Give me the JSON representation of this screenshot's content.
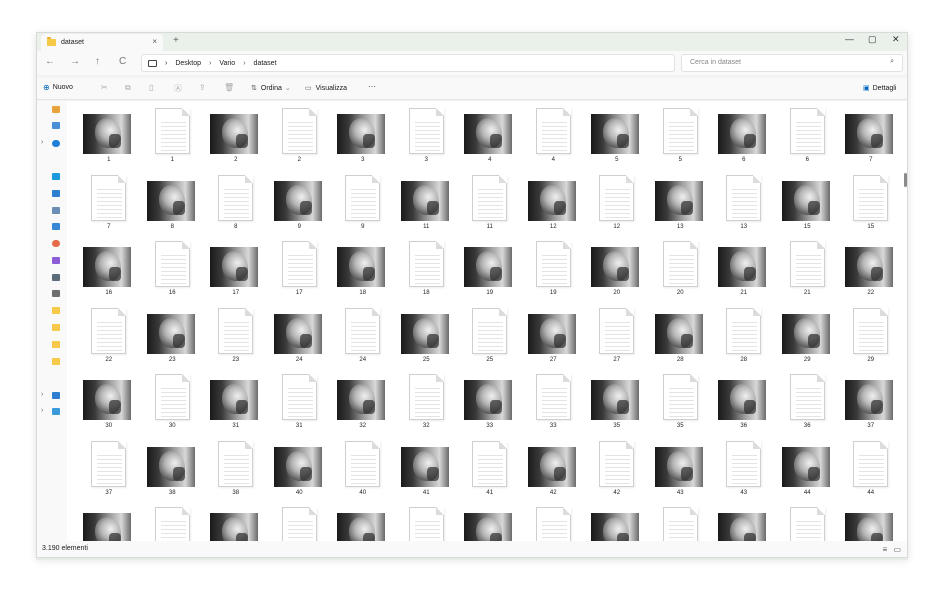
{
  "tab": {
    "title": "dataset",
    "close": "×",
    "new_tab": "+"
  },
  "window_controls": {
    "minimize": "—",
    "maximize": "▢",
    "close": "✕"
  },
  "nav": {
    "back": "←",
    "forward": "→",
    "up": "↑",
    "refresh": "C"
  },
  "breadcrumb": [
    "Desktop",
    "Vario",
    "dataset"
  ],
  "breadcrumb_separator": "›",
  "search": {
    "placeholder": "Cerca in dataset"
  },
  "commands": {
    "new_label": "Nuovo",
    "sort_label": "Ordina",
    "view_label": "Visualizza",
    "more_label": "···",
    "details_label": "Dettagli"
  },
  "status": {
    "item_count": "3.190 elementi"
  },
  "colors": {
    "accent": "#0067c0",
    "folder": "#f7c948"
  },
  "files": [
    {
      "t": "x",
      "n": "1"
    },
    {
      "t": "d",
      "n": "1"
    },
    {
      "t": "x",
      "n": "2"
    },
    {
      "t": "d",
      "n": "2"
    },
    {
      "t": "x",
      "n": "3"
    },
    {
      "t": "d",
      "n": "3"
    },
    {
      "t": "x",
      "n": "4"
    },
    {
      "t": "d",
      "n": "4"
    },
    {
      "t": "x",
      "n": "5"
    },
    {
      "t": "d",
      "n": "5"
    },
    {
      "t": "x",
      "n": "6"
    },
    {
      "t": "d",
      "n": "6"
    },
    {
      "t": "x",
      "n": "7"
    },
    {
      "t": "d",
      "n": "7"
    },
    {
      "t": "x",
      "n": "8"
    },
    {
      "t": "d",
      "n": "8"
    },
    {
      "t": "x",
      "n": "9"
    },
    {
      "t": "d",
      "n": "9"
    },
    {
      "t": "x",
      "n": "11"
    },
    {
      "t": "d",
      "n": "11"
    },
    {
      "t": "x",
      "n": "12"
    },
    {
      "t": "d",
      "n": "12"
    },
    {
      "t": "x",
      "n": "13"
    },
    {
      "t": "d",
      "n": "13"
    },
    {
      "t": "x",
      "n": "15"
    },
    {
      "t": "d",
      "n": "15"
    },
    {
      "t": "x",
      "n": "16"
    },
    {
      "t": "d",
      "n": "16"
    },
    {
      "t": "x",
      "n": "17"
    },
    {
      "t": "d",
      "n": "17"
    },
    {
      "t": "x",
      "n": "18"
    },
    {
      "t": "d",
      "n": "18"
    },
    {
      "t": "x",
      "n": "19"
    },
    {
      "t": "d",
      "n": "19"
    },
    {
      "t": "x",
      "n": "20"
    },
    {
      "t": "d",
      "n": "20"
    },
    {
      "t": "x",
      "n": "21"
    },
    {
      "t": "d",
      "n": "21"
    },
    {
      "t": "x",
      "n": "22"
    },
    {
      "t": "d",
      "n": "22"
    },
    {
      "t": "x",
      "n": "23"
    },
    {
      "t": "d",
      "n": "23"
    },
    {
      "t": "x",
      "n": "24"
    },
    {
      "t": "d",
      "n": "24"
    },
    {
      "t": "x",
      "n": "25"
    },
    {
      "t": "d",
      "n": "25"
    },
    {
      "t": "x",
      "n": "27"
    },
    {
      "t": "d",
      "n": "27"
    },
    {
      "t": "x",
      "n": "28"
    },
    {
      "t": "d",
      "n": "28"
    },
    {
      "t": "x",
      "n": "29"
    },
    {
      "t": "d",
      "n": "29"
    },
    {
      "t": "x",
      "n": "30"
    },
    {
      "t": "d",
      "n": "30"
    },
    {
      "t": "x",
      "n": "31"
    },
    {
      "t": "d",
      "n": "31"
    },
    {
      "t": "x",
      "n": "32"
    },
    {
      "t": "d",
      "n": "32"
    },
    {
      "t": "x",
      "n": "33"
    },
    {
      "t": "d",
      "n": "33"
    },
    {
      "t": "x",
      "n": "35"
    },
    {
      "t": "d",
      "n": "35"
    },
    {
      "t": "x",
      "n": "36"
    },
    {
      "t": "d",
      "n": "36"
    },
    {
      "t": "x",
      "n": "37"
    },
    {
      "t": "d",
      "n": "37"
    },
    {
      "t": "x",
      "n": "38"
    },
    {
      "t": "d",
      "n": "38"
    },
    {
      "t": "x",
      "n": "40"
    },
    {
      "t": "d",
      "n": "40"
    },
    {
      "t": "x",
      "n": "41"
    },
    {
      "t": "d",
      "n": "41"
    },
    {
      "t": "x",
      "n": "42"
    },
    {
      "t": "d",
      "n": "42"
    },
    {
      "t": "x",
      "n": "43"
    },
    {
      "t": "d",
      "n": "43"
    },
    {
      "t": "x",
      "n": "44"
    },
    {
      "t": "d",
      "n": "44"
    },
    {
      "t": "x",
      "n": ""
    },
    {
      "t": "d",
      "n": ""
    },
    {
      "t": "x",
      "n": ""
    },
    {
      "t": "d",
      "n": ""
    },
    {
      "t": "x",
      "n": ""
    },
    {
      "t": "d",
      "n": ""
    },
    {
      "t": "x",
      "n": ""
    },
    {
      "t": "d",
      "n": ""
    },
    {
      "t": "x",
      "n": ""
    },
    {
      "t": "d",
      "n": ""
    },
    {
      "t": "x",
      "n": ""
    },
    {
      "t": "d",
      "n": ""
    },
    {
      "t": "x",
      "n": ""
    }
  ]
}
